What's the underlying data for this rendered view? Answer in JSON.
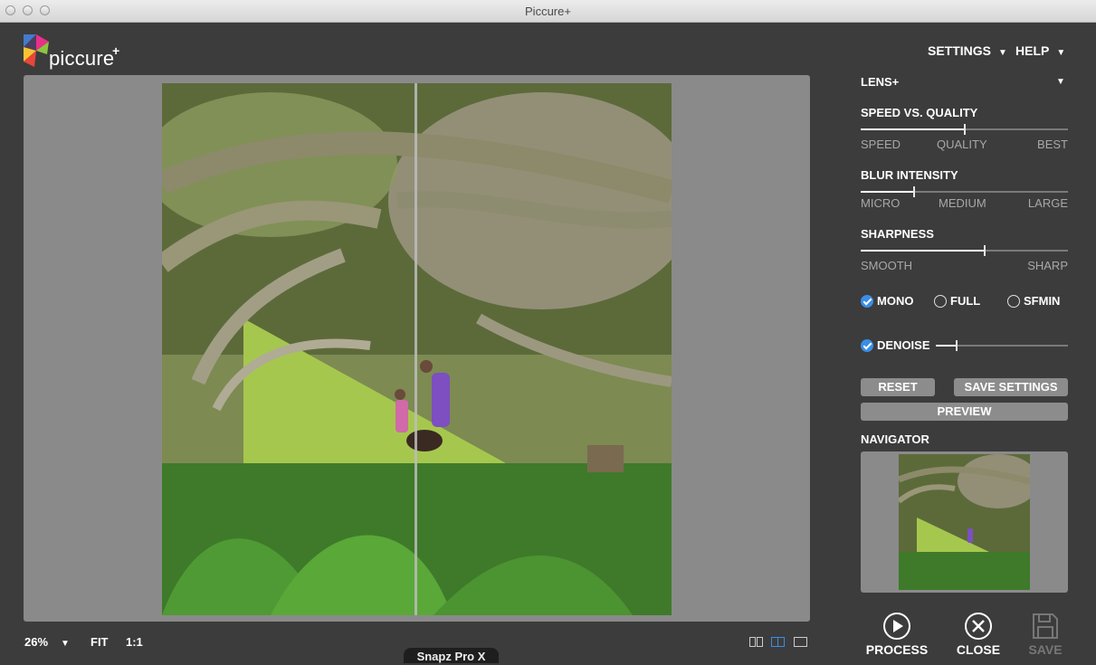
{
  "window": {
    "title": "Piccure+"
  },
  "app": {
    "logo_text": "piccure",
    "logo_plus": "+"
  },
  "menu": {
    "settings": "SETTINGS",
    "help": "HELP",
    "caret": "▼"
  },
  "panel": {
    "preset": {
      "label": "LENS+",
      "caret": "▼"
    },
    "speed_quality": {
      "title": "SPEED VS. QUALITY",
      "ticks": [
        "SPEED",
        "QUALITY",
        "BEST"
      ],
      "value": 0.5
    },
    "blur_intensity": {
      "title": "BLUR INTENSITY",
      "ticks": [
        "MICRO",
        "MEDIUM",
        "LARGE"
      ],
      "value": 0.25
    },
    "sharpness": {
      "title": "SHARPNESS",
      "ticks": [
        "SMOOTH",
        "SHARP"
      ],
      "value": 0.6
    },
    "modes": [
      {
        "label": "MONO",
        "selected": true
      },
      {
        "label": "FULL",
        "selected": false
      },
      {
        "label": "SFMIN",
        "selected": false
      }
    ],
    "denoise": {
      "label": "DENOISE",
      "checked": true,
      "value": 0.15
    },
    "buttons": {
      "reset": "RESET",
      "save_settings": "SAVE SETTINGS",
      "preview": "PREVIEW"
    },
    "navigator": {
      "title": "NAVIGATOR"
    },
    "actions": {
      "process": "PROCESS",
      "close": "CLOSE",
      "save": "SAVE"
    }
  },
  "bottombar": {
    "zoom": "26%",
    "caret": "▼",
    "fit": "FIT",
    "one_to_one": "1:1"
  },
  "overlay": {
    "snapz": "Snapz Pro X"
  },
  "colors": {
    "background": "#3c3c3c",
    "canvas": "#8a8a8a",
    "accent": "#3a8ee6",
    "button": "#8c8c8c"
  }
}
